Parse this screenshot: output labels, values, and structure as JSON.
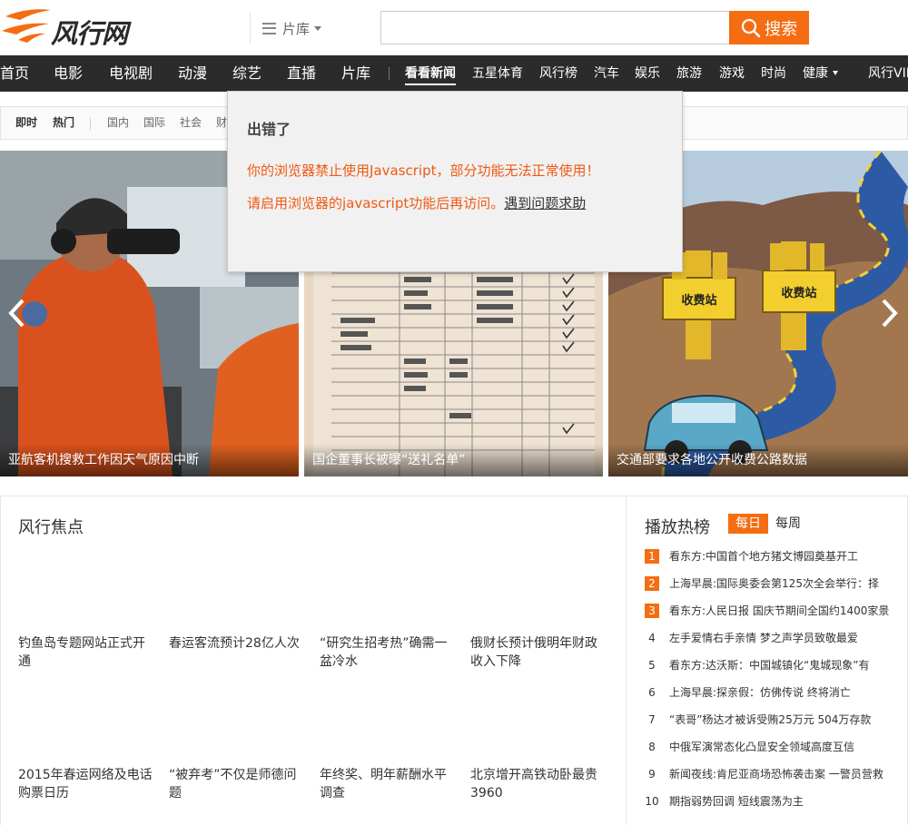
{
  "header": {
    "logo_text": "风行网",
    "library_menu_label": "片库",
    "search_placeholder": "",
    "search_button_label": "搜索"
  },
  "nav": {
    "items": [
      "首页",
      "电影",
      "电视剧",
      "动漫",
      "综艺",
      "直播",
      "片库",
      "看看新闻",
      "五星体育",
      "风行榜",
      "汽车",
      "娱乐",
      "旅游",
      "游戏",
      "时尚",
      "健康",
      "风行VIP"
    ],
    "active": "看看新闻"
  },
  "subnav": {
    "items": [
      "即时",
      "热门",
      "国内",
      "国际",
      "社会",
      "财"
    ]
  },
  "carousel": {
    "slides": [
      {
        "caption": "亚航客机搜救工作因天气原因中断",
        "image": "rescue-officer-binoculars"
      },
      {
        "caption": "国企董事长被曝“送礼名单”",
        "image": "gift-list-document"
      },
      {
        "caption": "交通部要求各地公开收费公路数据",
        "image": "toll-road-cartoon",
        "toll_text": "收费站"
      }
    ]
  },
  "error_dialog": {
    "title": "出错了",
    "message_1": "你的浏览器禁止使用Javascript，部分功能无法正常使用！",
    "message_2": "请启用浏览器的javascript功能后再访问。",
    "help_link": "遇到问题求助"
  },
  "focus": {
    "title": "风行焦点",
    "items": [
      "钓鱼岛专题网站正式开通",
      "春运客流预计28亿人次",
      "“研究生招考热”确需一盆冷水",
      "俄财长预计俄明年财政收入下降",
      "2015年春运网络及电话购票日历",
      "“被弃考”不仅是师德问题",
      "年终奖、明年薪酬水平调查",
      "北京增开高铁动卧最贵3960"
    ]
  },
  "ranking": {
    "title": "播放热榜",
    "tab_daily": "每日",
    "tab_weekly": "每周",
    "items": [
      {
        "rank": "1",
        "text": "看东方:中国首个地方猪文博园奠基开工"
      },
      {
        "rank": "2",
        "text": "上海早晨:国际奥委会第125次全会举行：择"
      },
      {
        "rank": "3",
        "text": "看东方:人民日报 国庆节期间全国约1400家景"
      },
      {
        "rank": "4",
        "text": "左手爱情右手亲情 梦之声学员致敬最爱"
      },
      {
        "rank": "5",
        "text": "看东方:达沃斯：中国城镇化“鬼城现象”有"
      },
      {
        "rank": "6",
        "text": "上海早晨:探亲假：仿佛传说 终将消亡"
      },
      {
        "rank": "7",
        "text": "“表哥”杨达才被诉受贿25万元 504万存款"
      },
      {
        "rank": "8",
        "text": "中俄军演常态化凸显安全领域高度互信"
      },
      {
        "rank": "9",
        "text": "新闻夜线:肯尼亚商场恐怖袭击案 一警员营救"
      },
      {
        "rank": "10",
        "text": "期指弱势回调 短线震荡为主"
      }
    ]
  },
  "colors": {
    "brand_orange": "#f46d12",
    "nav_bg": "#2b2b2b",
    "error_text": "#f05a13"
  }
}
